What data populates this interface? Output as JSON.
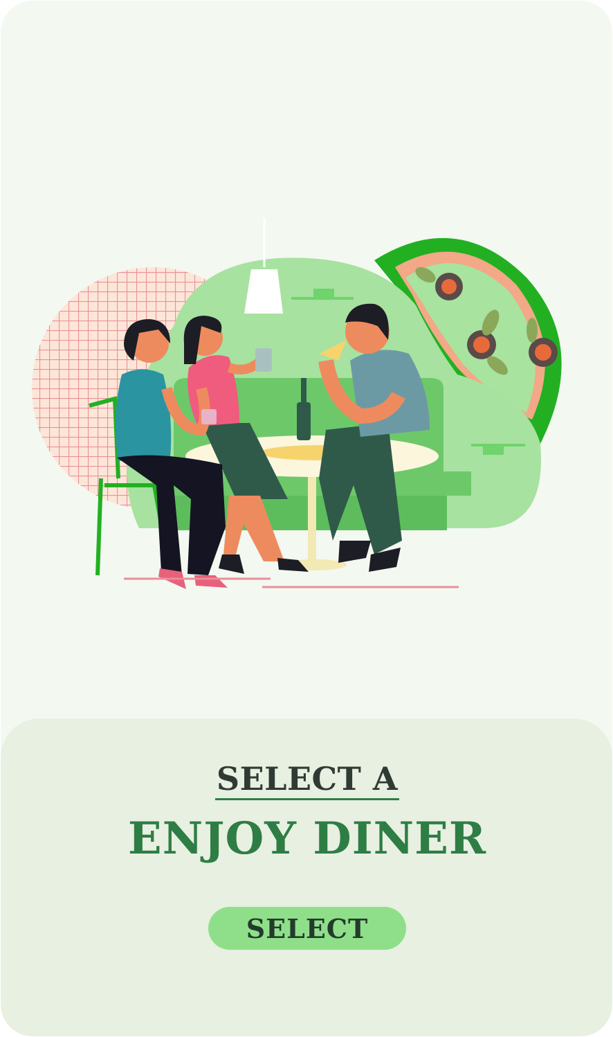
{
  "hero": {
    "illustration_icon": "diners-at-table-illustration"
  },
  "panel": {
    "subtitle": "SELECT A",
    "title": "ENJOY DINER",
    "select_label": "SELECT"
  },
  "colors": {
    "background": "#f3f8f1",
    "panel": "#e7f0e1",
    "accent_green": "#2e7d45",
    "button": "#8fdf8a",
    "illustration_green": "#22b022"
  }
}
